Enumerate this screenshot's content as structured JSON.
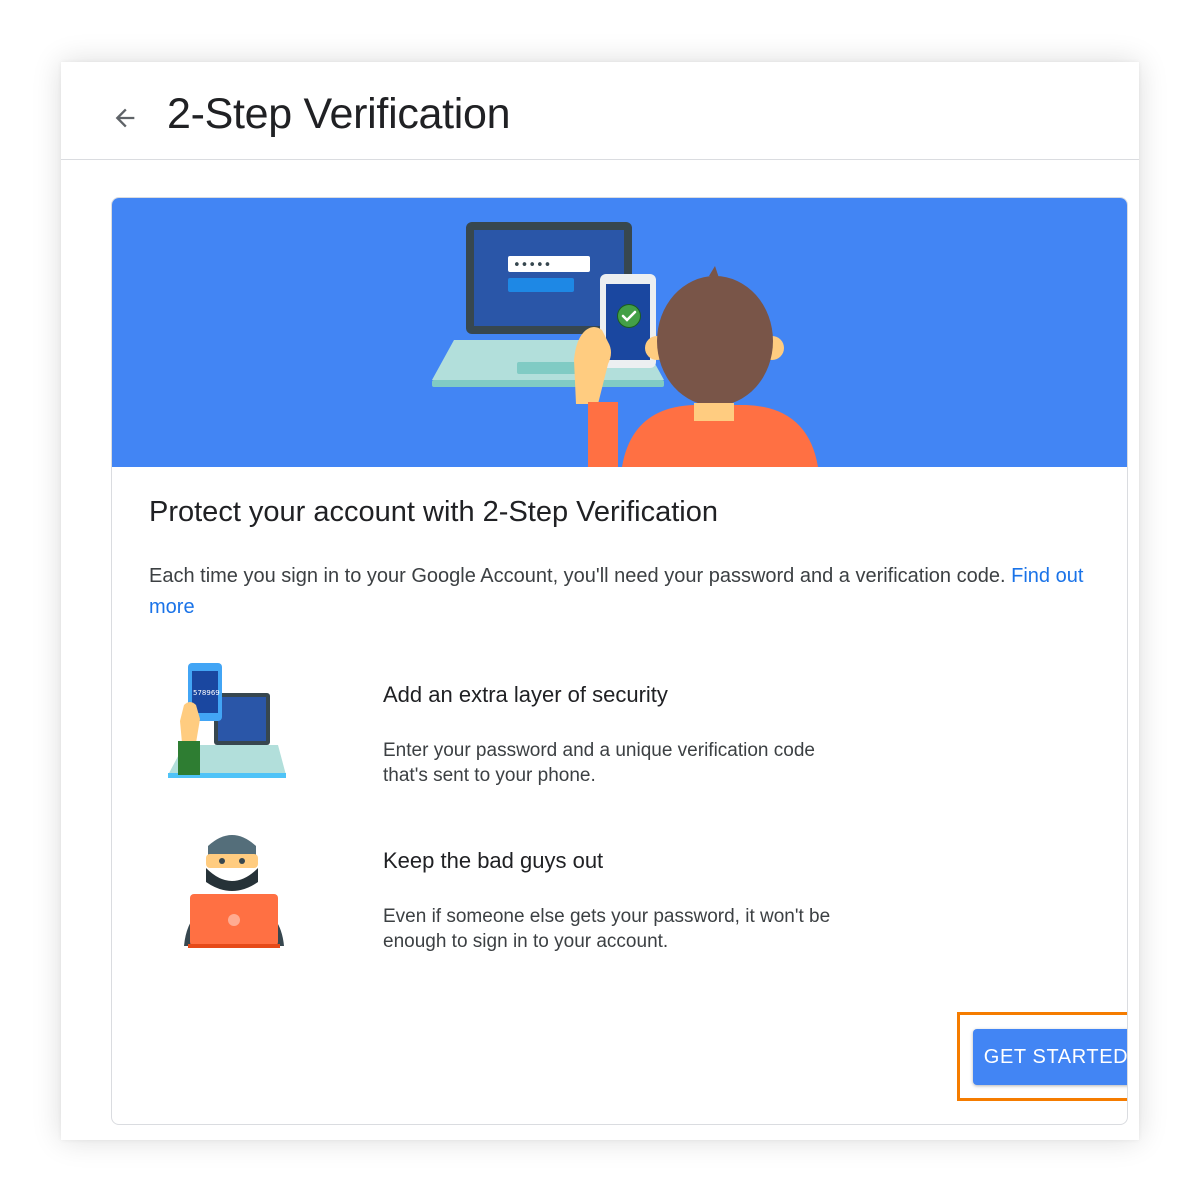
{
  "header": {
    "back_icon": "arrow-back-icon",
    "title": "2-Step Verification"
  },
  "banner": {
    "illustration": "laptop-phone-person-illustration",
    "masked_password": "•••••"
  },
  "card": {
    "heading": "Protect your account with 2-Step Verification",
    "description": "Each time you sign in to your Google Account, you'll need your password and a verification code.",
    "link_label": "Find out more"
  },
  "features": [
    {
      "icon": "phone-code-laptop-illustration",
      "code": "578969",
      "title": "Add an extra layer of security",
      "desc_line1": "Enter your password and a unique verification code",
      "desc_line2": "that's sent to your phone."
    },
    {
      "icon": "masked-hacker-illustration",
      "title": "Keep the bad guys out",
      "desc_line1": "Even if someone else gets your password, it won't be",
      "desc_line2": "enough to sign in to your account."
    }
  ],
  "actions": {
    "get_started_label": "GET STARTED"
  },
  "colors": {
    "accent": "#4285f4",
    "link": "#1a73e8",
    "highlight": "#f57c00",
    "person_shirt": "#ff7043"
  }
}
